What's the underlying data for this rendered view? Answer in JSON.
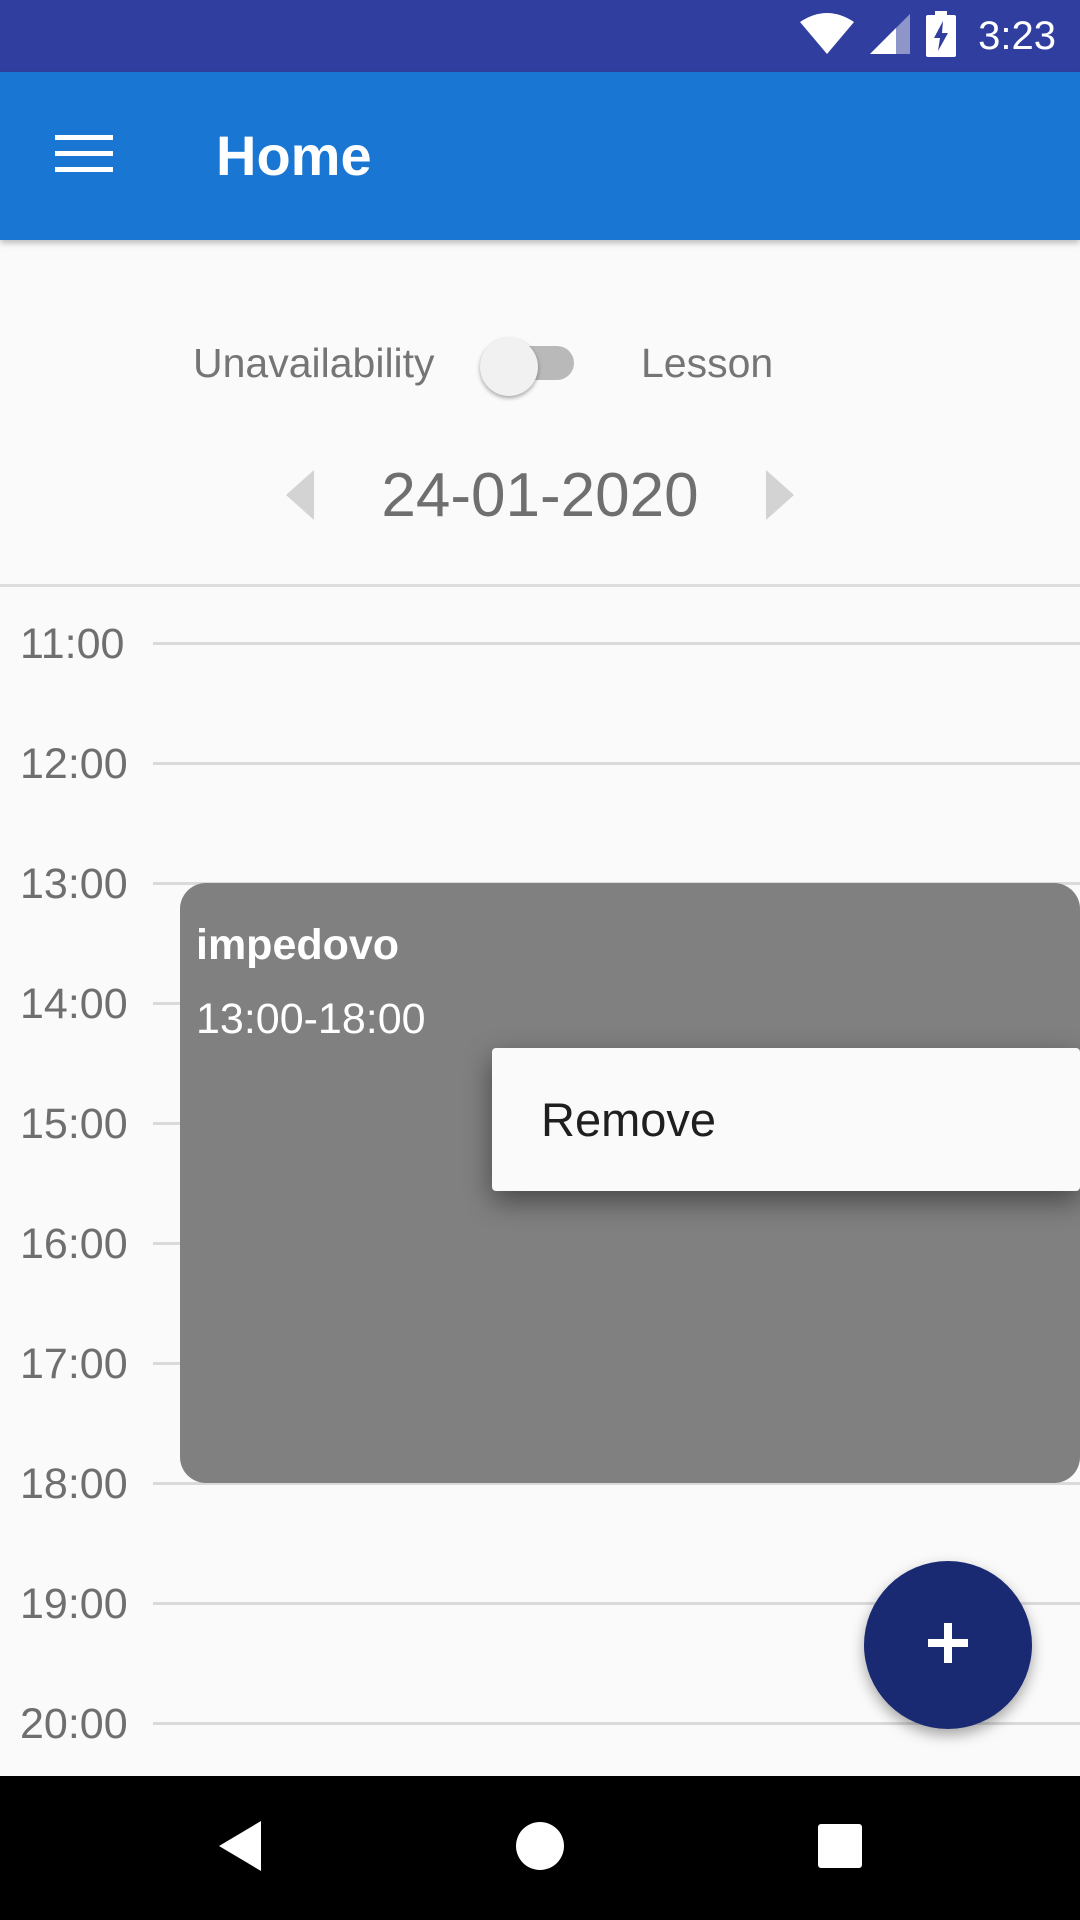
{
  "status_bar": {
    "time": "3:23",
    "icons": [
      "wifi-icon",
      "cellular-signal-icon",
      "battery-charging-icon"
    ]
  },
  "app_bar": {
    "title": "Home",
    "menu_icon": "hamburger-menu-icon",
    "color": "#1976d2"
  },
  "toggle": {
    "left_label": "Unavailability",
    "right_label": "Lesson",
    "checked": false
  },
  "date_nav": {
    "date": "24-01-2020",
    "prev_icon": "chevron-left-icon",
    "next_icon": "chevron-right-icon"
  },
  "timeline": {
    "hours": [
      "11:00",
      "12:00",
      "13:00",
      "14:00",
      "15:00",
      "16:00",
      "17:00",
      "18:00",
      "19:00",
      "20:00"
    ]
  },
  "event": {
    "title": "impedovo",
    "time_range": "13:00-18:00",
    "color": "#808080"
  },
  "context_menu": {
    "items": [
      "Remove"
    ]
  },
  "fab": {
    "icon": "plus-icon",
    "color": "#1a2a72"
  },
  "nav_bar": {
    "buttons": [
      "back-icon",
      "home-icon",
      "recents-icon"
    ]
  }
}
